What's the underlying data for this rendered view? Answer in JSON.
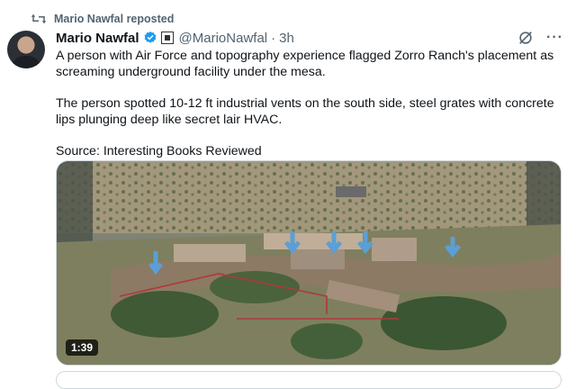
{
  "repost": {
    "label": "Mario Nawfal reposted",
    "icon": "repost-icon"
  },
  "post": {
    "author": "Mario Nawfal",
    "handle": "@MarioNawfal",
    "separator": "·",
    "time": "3h",
    "paragraphs": [
      "A person with Air Force and topography experience flagged Zorro Ranch's placement as screaming underground facility under the mesa.",
      "The person spotted 10-12 ft industrial vents on the south side, steel grates with concrete lips plunging deep like secret lair HVAC.",
      "Source: Interesting Books Reviewed"
    ],
    "more": "···"
  },
  "video": {
    "duration": "1:39"
  },
  "colors": {
    "verified": "#1d9bf0",
    "muted": "#536471",
    "arrow": "#5b9fd6"
  }
}
